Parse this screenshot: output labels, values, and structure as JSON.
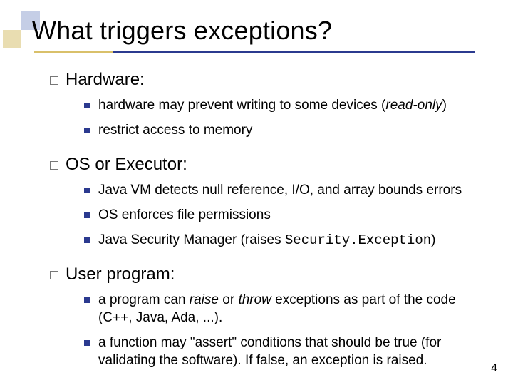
{
  "title": "What triggers exceptions?",
  "sect1": {
    "heading": "Hardware:",
    "b1a": "hardware may prevent writing to some devices (",
    "b1b": "read-only",
    "b1c": ")",
    "b2": "restrict access to memory"
  },
  "sect2": {
    "heading": "OS or Executor:",
    "b1": "Java VM detects null reference, I/O, and array bounds errors",
    "b2": "OS enforces file permissions",
    "b3a": "Java Security Manager (raises ",
    "b3b": "Security.Exception",
    "b3c": ")"
  },
  "sect3": {
    "heading": "User program:",
    "b1a": "a program can ",
    "b1b": "raise",
    "b1c": " or ",
    "b1d": "throw",
    "b1e": " exceptions as part of the code (C++, Java, Ada, ...).",
    "b2": "a function may \"assert\" conditions that should be true (for validating the software).  If false, an exception is raised."
  },
  "page_number": "4"
}
